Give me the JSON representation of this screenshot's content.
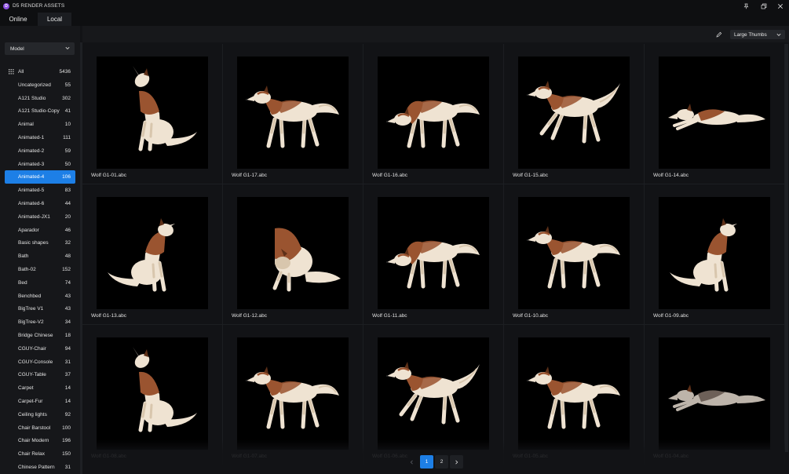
{
  "window": {
    "title": "D5 RENDER ASSETS",
    "logo_letter": "D",
    "controls": {
      "pin": "pin-icon",
      "restore": "restore-icon",
      "close": "close-icon"
    }
  },
  "tabs": [
    {
      "label": "Online",
      "active": false
    },
    {
      "label": "Local",
      "active": true
    }
  ],
  "sidebar": {
    "type_select": {
      "value": "Model"
    },
    "categories": [
      {
        "label": "All",
        "count": "5436",
        "icon": "grid-icon"
      },
      {
        "label": "Uncategorized",
        "count": "55"
      },
      {
        "label": "A121 Studio",
        "count": "302"
      },
      {
        "label": "A121 Studio-Copy",
        "count": "41"
      },
      {
        "label": "Animal",
        "count": "10"
      },
      {
        "label": "Animated-1",
        "count": "111"
      },
      {
        "label": "Animated-2",
        "count": "59"
      },
      {
        "label": "Animated-3",
        "count": "50"
      },
      {
        "label": "Animated-4",
        "count": "106",
        "active": true
      },
      {
        "label": "Animated-5",
        "count": "83"
      },
      {
        "label": "Animated-6",
        "count": "44"
      },
      {
        "label": "Animated-JX1",
        "count": "20"
      },
      {
        "label": "Aparador",
        "count": "46"
      },
      {
        "label": "Basic shapes",
        "count": "32"
      },
      {
        "label": "Bath",
        "count": "48"
      },
      {
        "label": "Bath-02",
        "count": "152"
      },
      {
        "label": "Bed",
        "count": "74"
      },
      {
        "label": "Benchbed",
        "count": "43"
      },
      {
        "label": "BigTree V1",
        "count": "43"
      },
      {
        "label": "BigTree-V2",
        "count": "34"
      },
      {
        "label": "Bridge Chinese",
        "count": "18"
      },
      {
        "label": "CGUY-Chair",
        "count": "94"
      },
      {
        "label": "CGUY-Console",
        "count": "31"
      },
      {
        "label": "CGUY-Table",
        "count": "37"
      },
      {
        "label": "Carpet",
        "count": "14"
      },
      {
        "label": "Carpet-Fur",
        "count": "14"
      },
      {
        "label": "Ceiling lights",
        "count": "92"
      },
      {
        "label": "Chair Barstool",
        "count": "100"
      },
      {
        "label": "Chair Modern",
        "count": "196"
      },
      {
        "label": "Chair Relax",
        "count": "150"
      },
      {
        "label": "Chinese Pattern",
        "count": "31"
      }
    ]
  },
  "toolbar": {
    "edit_icon": "pencil-icon",
    "view_select": {
      "value": "Large Thumbs"
    }
  },
  "assets": [
    {
      "name": "Wolf G1-01.abc",
      "pose": "howl"
    },
    {
      "name": "Wolf G1-17.abc",
      "pose": "run"
    },
    {
      "name": "Wolf G1-16.abc",
      "pose": "walk"
    },
    {
      "name": "Wolf G1-15.abc",
      "pose": "leap"
    },
    {
      "name": "Wolf G1-14.abc",
      "pose": "lying"
    },
    {
      "name": "Wolf G1-13.abc",
      "pose": "sit-howl"
    },
    {
      "name": "Wolf G1-12.abc",
      "pose": "crouch"
    },
    {
      "name": "Wolf G1-11.abc",
      "pose": "sniff"
    },
    {
      "name": "Wolf G1-10.abc",
      "pose": "snarl"
    },
    {
      "name": "Wolf G1-09.abc",
      "pose": "sit"
    },
    {
      "name": "Wolf G1-08.abc",
      "pose": "sit-howl-up"
    },
    {
      "name": "Wolf G1-07.abc",
      "pose": "run"
    },
    {
      "name": "Wolf G1-06.abc",
      "pose": "pounce"
    },
    {
      "name": "Wolf G1-05.abc",
      "pose": "snarl"
    },
    {
      "name": "Wolf G1-04.abc",
      "pose": "dead"
    }
  ],
  "pagination": {
    "prev": "chevron-left-icon",
    "pages": [
      "1",
      "2"
    ],
    "current": "1",
    "next": "chevron-right-icon"
  }
}
